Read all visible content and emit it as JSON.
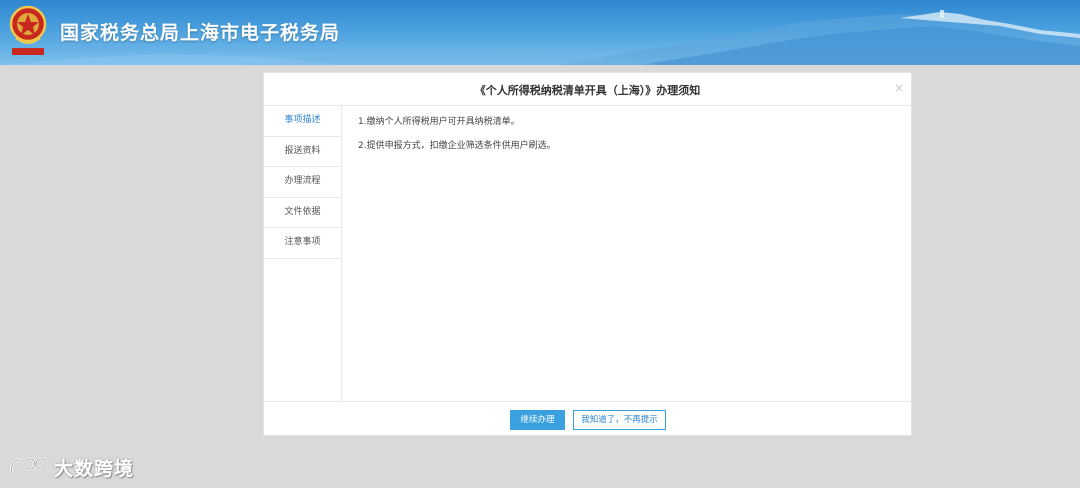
{
  "header": {
    "site_title": "国家税务总局上海市电子税务局",
    "emblem_icon": "tax-emblem-icon"
  },
  "modal": {
    "title": "《个人所得税纳税清单开具（上海）》办理须知",
    "close_label": "×",
    "nav_items": [
      {
        "label": "事项描述",
        "active": true
      },
      {
        "label": "报送资料",
        "active": false
      },
      {
        "label": "办理流程",
        "active": false
      },
      {
        "label": "文件依据",
        "active": false
      },
      {
        "label": "注意事项",
        "active": false
      }
    ],
    "content": [
      "1.缴纳个人所得税用户可开具纳税清单。",
      "2.提供申报方式，扣缴企业筛选条件供用户刷选。"
    ],
    "buttons": {
      "continue_label": "继续办理",
      "dismiss_label": "我知道了，不再提示"
    }
  },
  "watermark": {
    "text": "大数跨境"
  },
  "colors": {
    "accent": "#3aa0e0",
    "header_blue": "#2f86cf",
    "background": "#d9d9d9"
  }
}
